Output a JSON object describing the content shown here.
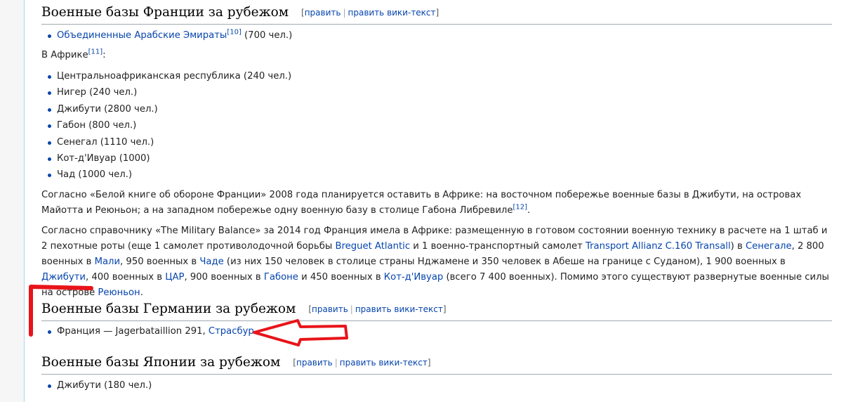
{
  "edit_labels": {
    "open": "[",
    "edit": "править",
    "sep": "|",
    "edit_source": "править вики-текст",
    "close": "]"
  },
  "france": {
    "heading": "Военные базы Франции за рубежом",
    "uae": {
      "link": "Объединенные Арабские Эмираты",
      "ref": "[10]",
      "text": " (700 чел.)"
    },
    "africa_intro": {
      "text": "В Африке",
      "ref": "[11]",
      "suffix": ":"
    },
    "africa_items": [
      "Центральноафриканская республика (240 чел.)",
      "Нигер (240 чел.)",
      "Джибути (2800 чел.)",
      "Габон (800 чел.)",
      "Сенегал (1110 чел.)",
      "Кот-д'Ивуар (1000)",
      "Чад (1000 чел.)"
    ],
    "para1": {
      "text": "Согласно «Белой книге об обороне Франции» 2008 года планируется оставить в Африке: на восточном побережье военные базы в Джибути, на островах Майотта и Реюньон; а на западном побережье одну военную базу в столице Габона Либревиле",
      "ref": "[12]",
      "suffix": "."
    },
    "para2": {
      "t1": "Согласно справочнику «The Military Balance» за 2014 год Франция имела в Африке: размещенную в готовом состоянии военную технику в расчете на 1 штаб и 2 пехотные роты (еще 1 самолет противолодочной борьбы ",
      "l1": "Breguet Atlantic",
      "t2": " и 1 военно-транспортный самолет ",
      "l2": "Transport Allianz C.160 Transall",
      "t3": ") в ",
      "l3": "Сенегале",
      "t4": ", 2 800 военных в ",
      "l4": "Мали",
      "t5": ", 950 военных в ",
      "l5": "Чаде",
      "t6": " (из них 150 человек в столице страны Нджамене и 350 человек в Абеше на границе с Суданом), 1 900 военных в ",
      "l6": "Джибути",
      "t7": ", 400 военных в ",
      "l7": "ЦАР",
      "t8": ", 900 военных в ",
      "l8": "Габоне",
      "t9": " и 450 военных в ",
      "l9": "Кот-д'Ивуар",
      "t10": " (всего 7 400 военных). Помимо этого существуют развернутые военные силы на острове ",
      "l10": "Реюньон",
      "t11": "."
    }
  },
  "germany": {
    "heading": "Военные базы Германии за рубежом",
    "item_text": "Франция — Jagerbataillion 291, ",
    "item_link": "Страсбур"
  },
  "japan": {
    "heading": "Военные базы Японии за рубежом",
    "item_text": "Джибути (180 чел.)"
  },
  "colors": {
    "link": "#0645ad",
    "annotation": "#e8141a"
  }
}
